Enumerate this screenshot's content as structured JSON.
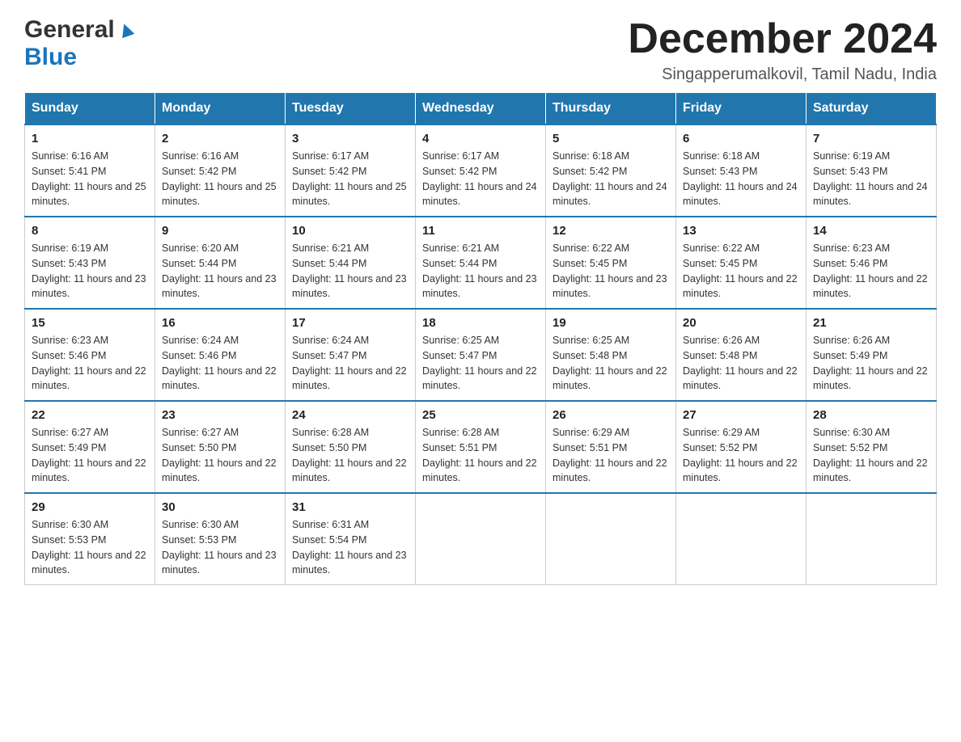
{
  "logo": {
    "general": "General",
    "blue": "Blue"
  },
  "header": {
    "month_year": "December 2024",
    "location": "Singapperumalkovil, Tamil Nadu, India"
  },
  "weekdays": [
    "Sunday",
    "Monday",
    "Tuesday",
    "Wednesday",
    "Thursday",
    "Friday",
    "Saturday"
  ],
  "weeks": [
    [
      {
        "day": "1",
        "sunrise": "6:16 AM",
        "sunset": "5:41 PM",
        "daylight": "11 hours and 25 minutes."
      },
      {
        "day": "2",
        "sunrise": "6:16 AM",
        "sunset": "5:42 PM",
        "daylight": "11 hours and 25 minutes."
      },
      {
        "day": "3",
        "sunrise": "6:17 AM",
        "sunset": "5:42 PM",
        "daylight": "11 hours and 25 minutes."
      },
      {
        "day": "4",
        "sunrise": "6:17 AM",
        "sunset": "5:42 PM",
        "daylight": "11 hours and 24 minutes."
      },
      {
        "day": "5",
        "sunrise": "6:18 AM",
        "sunset": "5:42 PM",
        "daylight": "11 hours and 24 minutes."
      },
      {
        "day": "6",
        "sunrise": "6:18 AM",
        "sunset": "5:43 PM",
        "daylight": "11 hours and 24 minutes."
      },
      {
        "day": "7",
        "sunrise": "6:19 AM",
        "sunset": "5:43 PM",
        "daylight": "11 hours and 24 minutes."
      }
    ],
    [
      {
        "day": "8",
        "sunrise": "6:19 AM",
        "sunset": "5:43 PM",
        "daylight": "11 hours and 23 minutes."
      },
      {
        "day": "9",
        "sunrise": "6:20 AM",
        "sunset": "5:44 PM",
        "daylight": "11 hours and 23 minutes."
      },
      {
        "day": "10",
        "sunrise": "6:21 AM",
        "sunset": "5:44 PM",
        "daylight": "11 hours and 23 minutes."
      },
      {
        "day": "11",
        "sunrise": "6:21 AM",
        "sunset": "5:44 PM",
        "daylight": "11 hours and 23 minutes."
      },
      {
        "day": "12",
        "sunrise": "6:22 AM",
        "sunset": "5:45 PM",
        "daylight": "11 hours and 23 minutes."
      },
      {
        "day": "13",
        "sunrise": "6:22 AM",
        "sunset": "5:45 PM",
        "daylight": "11 hours and 22 minutes."
      },
      {
        "day": "14",
        "sunrise": "6:23 AM",
        "sunset": "5:46 PM",
        "daylight": "11 hours and 22 minutes."
      }
    ],
    [
      {
        "day": "15",
        "sunrise": "6:23 AM",
        "sunset": "5:46 PM",
        "daylight": "11 hours and 22 minutes."
      },
      {
        "day": "16",
        "sunrise": "6:24 AM",
        "sunset": "5:46 PM",
        "daylight": "11 hours and 22 minutes."
      },
      {
        "day": "17",
        "sunrise": "6:24 AM",
        "sunset": "5:47 PM",
        "daylight": "11 hours and 22 minutes."
      },
      {
        "day": "18",
        "sunrise": "6:25 AM",
        "sunset": "5:47 PM",
        "daylight": "11 hours and 22 minutes."
      },
      {
        "day": "19",
        "sunrise": "6:25 AM",
        "sunset": "5:48 PM",
        "daylight": "11 hours and 22 minutes."
      },
      {
        "day": "20",
        "sunrise": "6:26 AM",
        "sunset": "5:48 PM",
        "daylight": "11 hours and 22 minutes."
      },
      {
        "day": "21",
        "sunrise": "6:26 AM",
        "sunset": "5:49 PM",
        "daylight": "11 hours and 22 minutes."
      }
    ],
    [
      {
        "day": "22",
        "sunrise": "6:27 AM",
        "sunset": "5:49 PM",
        "daylight": "11 hours and 22 minutes."
      },
      {
        "day": "23",
        "sunrise": "6:27 AM",
        "sunset": "5:50 PM",
        "daylight": "11 hours and 22 minutes."
      },
      {
        "day": "24",
        "sunrise": "6:28 AM",
        "sunset": "5:50 PM",
        "daylight": "11 hours and 22 minutes."
      },
      {
        "day": "25",
        "sunrise": "6:28 AM",
        "sunset": "5:51 PM",
        "daylight": "11 hours and 22 minutes."
      },
      {
        "day": "26",
        "sunrise": "6:29 AM",
        "sunset": "5:51 PM",
        "daylight": "11 hours and 22 minutes."
      },
      {
        "day": "27",
        "sunrise": "6:29 AM",
        "sunset": "5:52 PM",
        "daylight": "11 hours and 22 minutes."
      },
      {
        "day": "28",
        "sunrise": "6:30 AM",
        "sunset": "5:52 PM",
        "daylight": "11 hours and 22 minutes."
      }
    ],
    [
      {
        "day": "29",
        "sunrise": "6:30 AM",
        "sunset": "5:53 PM",
        "daylight": "11 hours and 22 minutes."
      },
      {
        "day": "30",
        "sunrise": "6:30 AM",
        "sunset": "5:53 PM",
        "daylight": "11 hours and 23 minutes."
      },
      {
        "day": "31",
        "sunrise": "6:31 AM",
        "sunset": "5:54 PM",
        "daylight": "11 hours and 23 minutes."
      },
      null,
      null,
      null,
      null
    ]
  ]
}
